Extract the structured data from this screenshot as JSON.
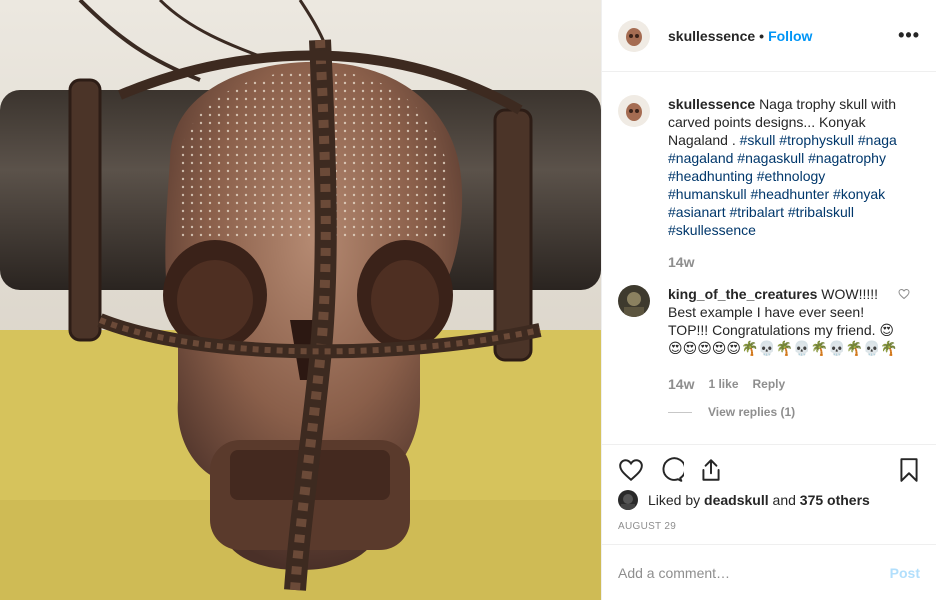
{
  "post": {
    "author": "skullessence",
    "follow_separator": "•",
    "follow_label": "Follow",
    "more_label": "•••"
  },
  "caption": {
    "author": "skullessence",
    "text": "Naga trophy skull with carved points designs... Konyak Nagaland .",
    "hashtags": [
      "#skull",
      "#trophyskull",
      "#naga",
      "#nagaland",
      "#nagaskull",
      "#nagatrophy",
      "#headhunting",
      "#ethnology",
      "#humanskull",
      "#headhunter",
      "#konyak",
      "#asianart",
      "#tribalart",
      "#tribalskull",
      "#skullessence"
    ],
    "age": "14w"
  },
  "comment": {
    "author": "king_of_the_creatures",
    "text": "WOW!!!!! Best example I have ever seen! TOP!!! Congratulations my friend.",
    "emojis": "😍😍😍😍😍😍🌴💀🌴💀🌴💀🌴💀🌴",
    "age": "14w",
    "likes": "1 like",
    "reply_label": "Reply",
    "view_replies": "View replies (1)"
  },
  "icons": {
    "like": "heart-icon",
    "comment": "comment-icon",
    "share": "share-icon",
    "save": "bookmark-icon"
  },
  "likes": {
    "prefix": "Liked by",
    "user": "deadskull",
    "joiner": "and",
    "others": "375 others"
  },
  "date": "AUGUST 29",
  "add_comment": {
    "placeholder": "Add a comment…",
    "post_label": "Post"
  },
  "colors": {
    "link_blue": "#0095f6",
    "hashtag": "#00376b",
    "muted": "#8e8e8e",
    "post_disabled": "#b2dffc"
  }
}
